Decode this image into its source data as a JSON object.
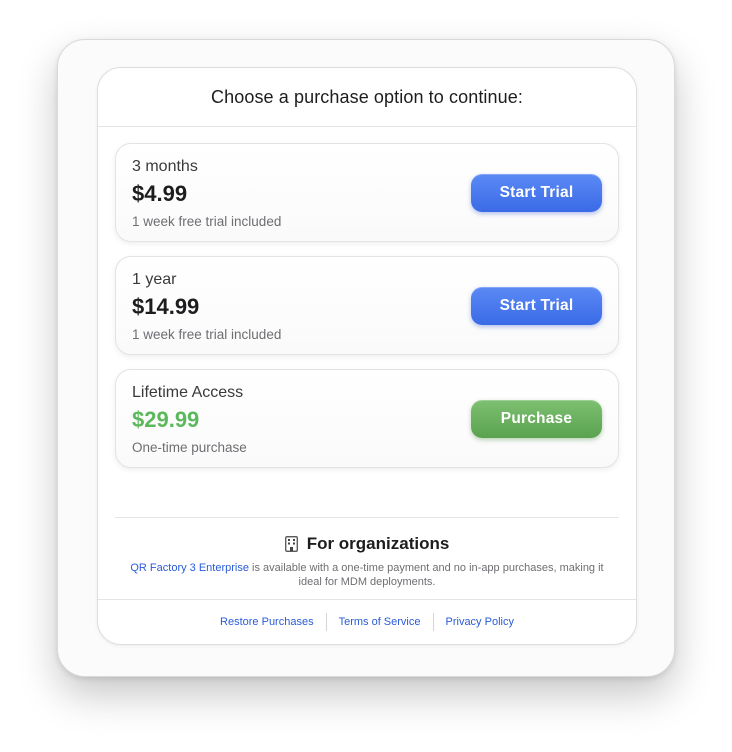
{
  "sheet": {
    "title": "Choose a purchase option to continue:"
  },
  "options": [
    {
      "name": "3 months",
      "price": "$4.99",
      "note": "1 week free trial included",
      "button_label": "Start Trial"
    },
    {
      "name": "1 year",
      "price": "$14.99",
      "note": "1 week free trial included",
      "button_label": "Start Trial"
    },
    {
      "name": "Lifetime Access",
      "price": "$29.99",
      "note": "One-time purchase",
      "button_label": "Purchase"
    }
  ],
  "organizations": {
    "icon": "building-icon",
    "title": "For organizations",
    "link_text": "QR Factory 3 Enterprise",
    "description": " is available with a one-time payment and no in-app purchases, making it ideal for MDM deployments."
  },
  "footer": {
    "restore_label": "Restore Purchases",
    "terms_label": "Terms of Service",
    "privacy_label": "Privacy Policy"
  },
  "colors": {
    "trial_button": "#3a6ae6",
    "purchase_button": "#5aa24f",
    "lifetime_price": "#5cb85c",
    "link": "#2a5bd7"
  }
}
